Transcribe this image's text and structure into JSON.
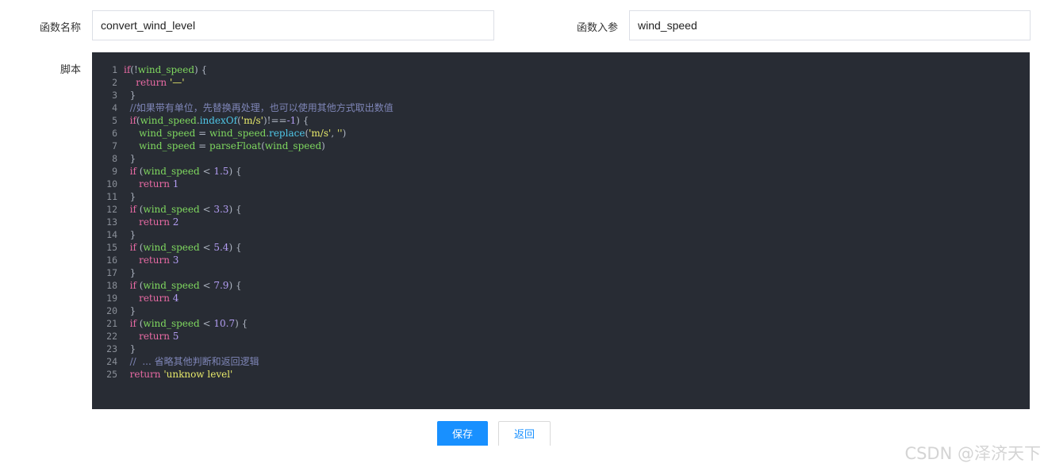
{
  "form": {
    "function_name_label": "函数名称",
    "function_name_value": "convert_wind_level",
    "function_param_label": "函数入参",
    "function_param_value": "wind_speed",
    "script_label": "脚本"
  },
  "editor": {
    "lines": [
      {
        "n": "1",
        "tokens": [
          [
            "kw",
            "if"
          ],
          [
            "op",
            "(!"
          ],
          [
            "var",
            "wind_speed"
          ],
          [
            "op",
            ") {"
          ]
        ]
      },
      {
        "n": "2",
        "tokens": [
          [
            "plain",
            "    "
          ],
          [
            "kw",
            "return"
          ],
          [
            "plain",
            " "
          ],
          [
            "str",
            "'—'"
          ]
        ]
      },
      {
        "n": "3",
        "tokens": [
          [
            "op",
            "  }"
          ]
        ]
      },
      {
        "n": "4",
        "tokens": [
          [
            "cmt",
            "  //如果带有单位，先替换再处理，也可以使用其他方式取出数值"
          ]
        ]
      },
      {
        "n": "5",
        "tokens": [
          [
            "plain",
            "  "
          ],
          [
            "kw",
            "if"
          ],
          [
            "op",
            "("
          ],
          [
            "var",
            "wind_speed"
          ],
          [
            "op",
            "."
          ],
          [
            "fn",
            "indexOf"
          ],
          [
            "op",
            "("
          ],
          [
            "str",
            "'m/s'"
          ],
          [
            "op",
            ")!=="
          ],
          [
            "num",
            "-1"
          ],
          [
            "op",
            ") {"
          ]
        ]
      },
      {
        "n": "6",
        "tokens": [
          [
            "plain",
            "     "
          ],
          [
            "var",
            "wind_speed"
          ],
          [
            "op",
            " = "
          ],
          [
            "var",
            "wind_speed"
          ],
          [
            "op",
            "."
          ],
          [
            "fn",
            "replace"
          ],
          [
            "op",
            "("
          ],
          [
            "str",
            "'m/s'"
          ],
          [
            "op",
            ", "
          ],
          [
            "str",
            "''"
          ],
          [
            "op",
            ")"
          ]
        ]
      },
      {
        "n": "7",
        "tokens": [
          [
            "plain",
            "     "
          ],
          [
            "var",
            "wind_speed"
          ],
          [
            "op",
            " = "
          ],
          [
            "var",
            "parseFloat"
          ],
          [
            "op",
            "("
          ],
          [
            "var",
            "wind_speed"
          ],
          [
            "op",
            ")"
          ]
        ]
      },
      {
        "n": "8",
        "tokens": [
          [
            "op",
            "  }"
          ]
        ]
      },
      {
        "n": "9",
        "tokens": [
          [
            "plain",
            "  "
          ],
          [
            "kw",
            "if"
          ],
          [
            "op",
            " ("
          ],
          [
            "var",
            "wind_speed"
          ],
          [
            "op",
            " < "
          ],
          [
            "num",
            "1.5"
          ],
          [
            "op",
            ") {"
          ]
        ]
      },
      {
        "n": "10",
        "tokens": [
          [
            "plain",
            "     "
          ],
          [
            "kw",
            "return"
          ],
          [
            "plain",
            " "
          ],
          [
            "num",
            "1"
          ]
        ]
      },
      {
        "n": "11",
        "tokens": [
          [
            "op",
            "  }"
          ]
        ]
      },
      {
        "n": "12",
        "tokens": [
          [
            "plain",
            "  "
          ],
          [
            "kw",
            "if"
          ],
          [
            "op",
            " ("
          ],
          [
            "var",
            "wind_speed"
          ],
          [
            "op",
            " < "
          ],
          [
            "num",
            "3.3"
          ],
          [
            "op",
            ") {"
          ]
        ]
      },
      {
        "n": "13",
        "tokens": [
          [
            "plain",
            "     "
          ],
          [
            "kw",
            "return"
          ],
          [
            "plain",
            " "
          ],
          [
            "num",
            "2"
          ]
        ]
      },
      {
        "n": "14",
        "tokens": [
          [
            "op",
            "  }"
          ]
        ]
      },
      {
        "n": "15",
        "tokens": [
          [
            "plain",
            "  "
          ],
          [
            "kw",
            "if"
          ],
          [
            "op",
            " ("
          ],
          [
            "var",
            "wind_speed"
          ],
          [
            "op",
            " < "
          ],
          [
            "num",
            "5.4"
          ],
          [
            "op",
            ") {"
          ]
        ]
      },
      {
        "n": "16",
        "tokens": [
          [
            "plain",
            "     "
          ],
          [
            "kw",
            "return"
          ],
          [
            "plain",
            " "
          ],
          [
            "num",
            "3"
          ]
        ]
      },
      {
        "n": "17",
        "tokens": [
          [
            "op",
            "  }"
          ]
        ]
      },
      {
        "n": "18",
        "tokens": [
          [
            "plain",
            "  "
          ],
          [
            "kw",
            "if"
          ],
          [
            "op",
            " ("
          ],
          [
            "var",
            "wind_speed"
          ],
          [
            "op",
            " < "
          ],
          [
            "num",
            "7.9"
          ],
          [
            "op",
            ") {"
          ]
        ]
      },
      {
        "n": "19",
        "tokens": [
          [
            "plain",
            "     "
          ],
          [
            "kw",
            "return"
          ],
          [
            "plain",
            " "
          ],
          [
            "num",
            "4"
          ]
        ]
      },
      {
        "n": "20",
        "tokens": [
          [
            "op",
            "  }"
          ]
        ]
      },
      {
        "n": "21",
        "tokens": [
          [
            "plain",
            "  "
          ],
          [
            "kw",
            "if"
          ],
          [
            "op",
            " ("
          ],
          [
            "var",
            "wind_speed"
          ],
          [
            "op",
            " < "
          ],
          [
            "num",
            "10.7"
          ],
          [
            "op",
            ") {"
          ]
        ]
      },
      {
        "n": "22",
        "tokens": [
          [
            "plain",
            "     "
          ],
          [
            "kw",
            "return"
          ],
          [
            "plain",
            " "
          ],
          [
            "num",
            "5"
          ]
        ]
      },
      {
        "n": "23",
        "tokens": [
          [
            "op",
            "  }"
          ]
        ]
      },
      {
        "n": "24",
        "tokens": [
          [
            "cmt",
            "  //  ... 省略其他判断和返回逻辑"
          ]
        ]
      },
      {
        "n": "25",
        "tokens": [
          [
            "plain",
            "  "
          ],
          [
            "kw",
            "return"
          ],
          [
            "plain",
            " "
          ],
          [
            "str",
            "'unknow level'"
          ]
        ]
      }
    ]
  },
  "actions": {
    "save_label": "保存",
    "back_label": "返回"
  },
  "watermark": "CSDN @泽济天下",
  "colors": {
    "primary": "#1890ff",
    "editor_bg": "#282c34"
  }
}
